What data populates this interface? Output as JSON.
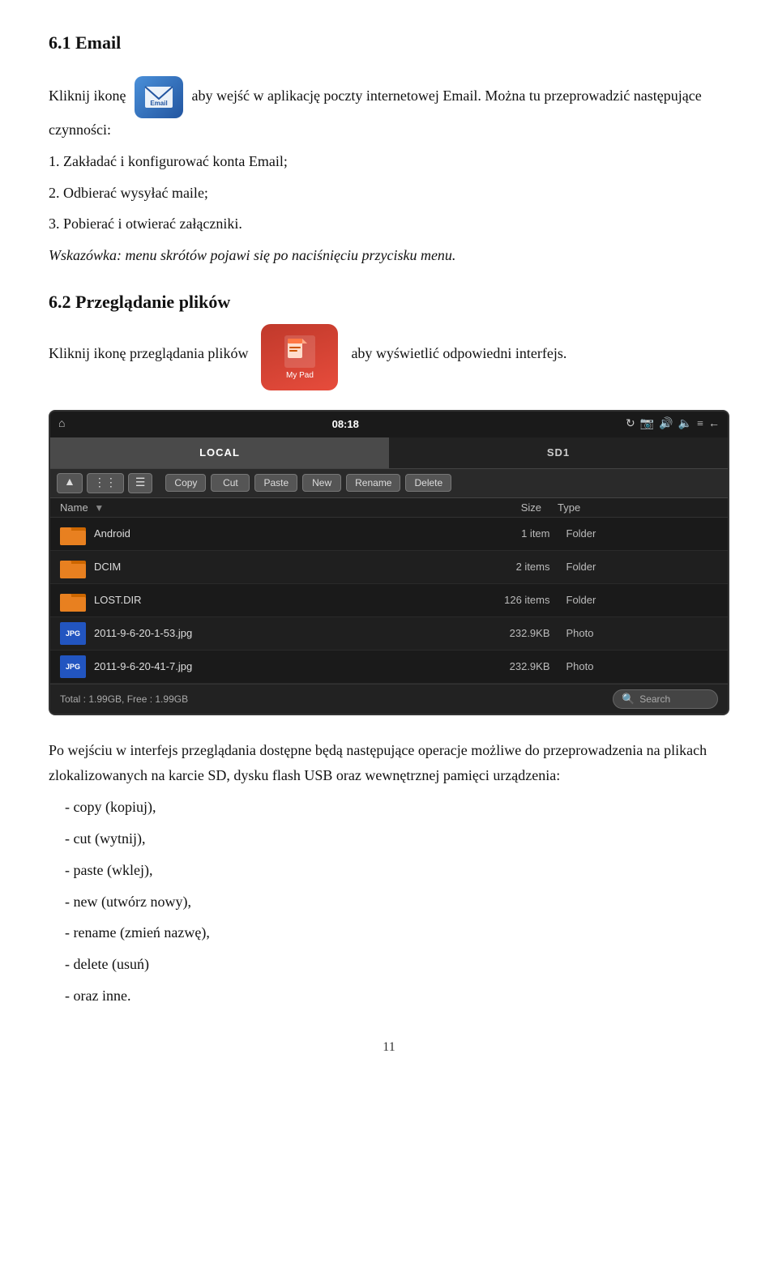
{
  "section1": {
    "title": "6.1 Email",
    "para1": "Kliknij ikonę",
    "para1b": "aby wejść w aplikację poczty internetowej Email. Można tu przeprowadzić następujące czynności:",
    "item1": "1. Zakładać i konfigurować konta Email;",
    "item2": "2. Odbierać wysyłać maile;",
    "item3": "3. Pobierać i otwierać załączniki.",
    "hint": "Wskazówka: menu skrótów pojawi się po naciśnięciu przycisku menu."
  },
  "section2": {
    "title": "6.2 Przeglądanie plików",
    "intro1": "Kliknij ikonę przeglądania plików",
    "intro2": "aby wyświetlić odpowiedni interfejs."
  },
  "statusbar": {
    "time": "08:18"
  },
  "tabs": {
    "local": "LOCAL",
    "sd": "SD1"
  },
  "toolbar": {
    "up": "▲",
    "grid": "⋮⋮",
    "list": "☰",
    "copy": "Copy",
    "cut": "Cut",
    "paste": "Paste",
    "new": "New",
    "rename": "Rename",
    "delete": "Delete"
  },
  "columns": {
    "name": "Name",
    "size": "Size",
    "type": "Type"
  },
  "files": [
    {
      "name": "Android",
      "size": "1 item",
      "type": "Folder",
      "icon": "folder"
    },
    {
      "name": "DCIM",
      "size": "2 items",
      "type": "Folder",
      "icon": "folder"
    },
    {
      "name": "LOST.DIR",
      "size": "126 items",
      "type": "Folder",
      "icon": "folder"
    },
    {
      "name": "2011-9-6-20-1-53.jpg",
      "size": "232.9KB",
      "type": "Photo",
      "icon": "jpg"
    },
    {
      "name": "2011-9-6-20-41-7.jpg",
      "size": "232.9KB",
      "type": "Photo",
      "icon": "jpg"
    }
  ],
  "footer": {
    "storage": "Total : 1.99GB, Free : 1.99GB",
    "search_placeholder": "Search"
  },
  "body_text": {
    "intro": "Po wejściu w interfejs przeglądania dostępne będą następujące operacje możliwe do przeprowadzenia na plikach zlokalizowanych na karcie SD, dysku flash USB oraz wewnętrznej pamięci urządzenia:",
    "items": [
      "- copy (kopiuj),",
      "- cut (wytnij),",
      "- paste (wklej),",
      "- new (utwórz nowy),",
      "- rename (zmień nazwę),",
      "- delete (usuń)",
      "- oraz inne."
    ]
  },
  "page_number": "11"
}
